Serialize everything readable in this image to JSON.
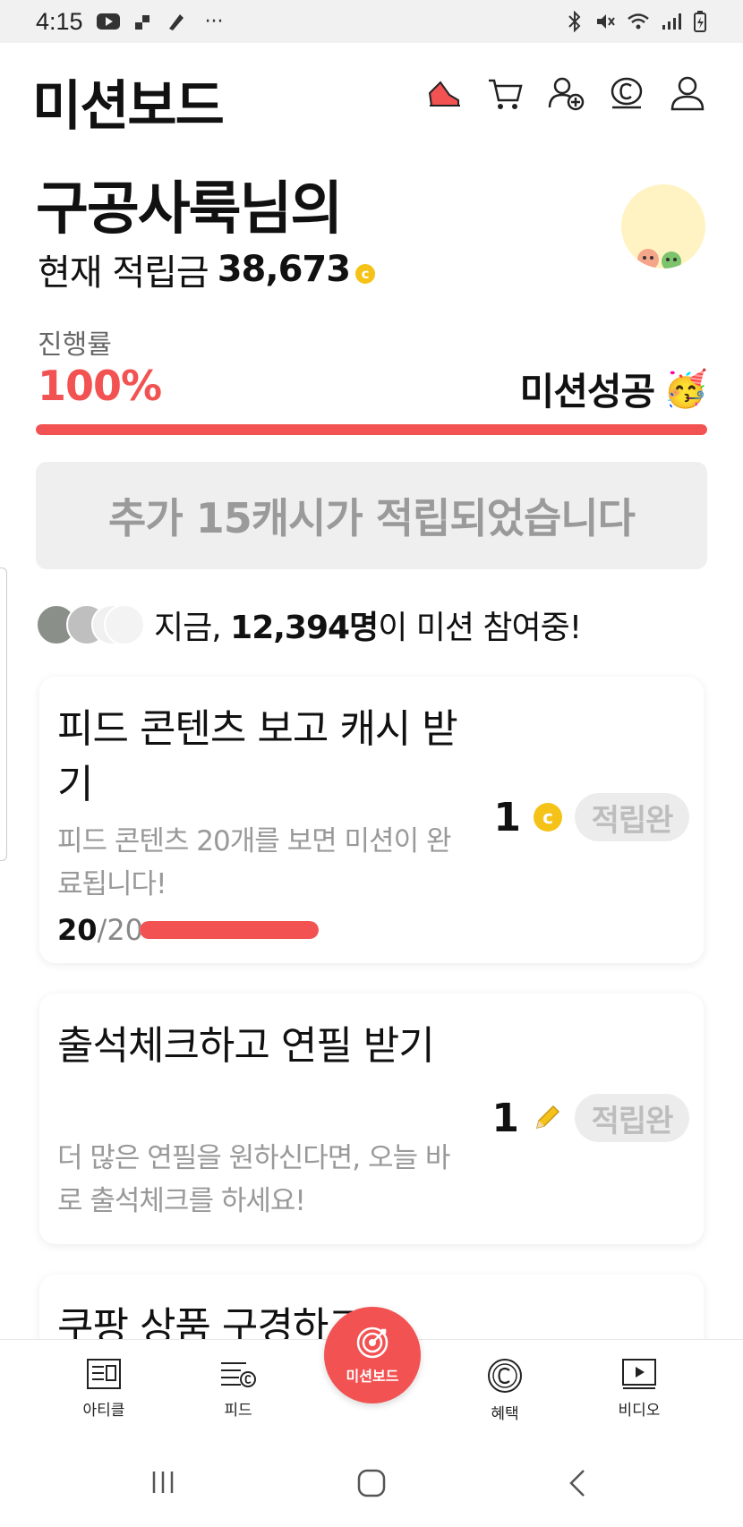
{
  "status_bar": {
    "time": "4:15",
    "dots": "···"
  },
  "header": {
    "title": "미션보드"
  },
  "profile": {
    "user_line": "구공사룩님의",
    "balance_label": "현재 적립금",
    "balance_value": "38,673",
    "coin_symbol": "c"
  },
  "progress": {
    "label": "진행률",
    "value_text": "100%",
    "fraction": 1.0,
    "success_label": "미션성공",
    "success_emoji": "🥳"
  },
  "banner": {
    "text": "추가 15캐시가 적립되었습니다"
  },
  "participants": {
    "prefix": "지금, ",
    "count": "12,394명",
    "suffix": "이 미션 참여중!"
  },
  "missions": [
    {
      "title": "피드 콘텐츠 보고 캐시 받기",
      "desc": "피드 콘텐츠 20개를 보면 미션이 완료됩니다!",
      "reward": "1",
      "reward_icon": "coin-icon",
      "status": "적립완",
      "progress_done": "20",
      "progress_total": "/20",
      "progress_fraction": 1.0
    },
    {
      "title": "출석체크하고 연필 받기",
      "desc": "더 많은 연필을 원하신다면, 오늘 바로 출석체크를 하세요!",
      "reward": "1",
      "reward_icon": "pencil-icon",
      "status": "적립완"
    },
    {
      "title": "쿠팡 상품 구경하고"
    }
  ],
  "bottom_nav": [
    {
      "label": "아티클",
      "icon": "article-icon"
    },
    {
      "label": "피드",
      "icon": "feed-icon"
    },
    {
      "label": "미션보드",
      "icon": "target-icon"
    },
    {
      "label": "혜택",
      "icon": "benefit-icon"
    },
    {
      "label": "비디오",
      "icon": "video-icon"
    }
  ],
  "colors": {
    "accent": "#f25252",
    "coin": "#f5c218",
    "muted": "#9a9a9a"
  }
}
